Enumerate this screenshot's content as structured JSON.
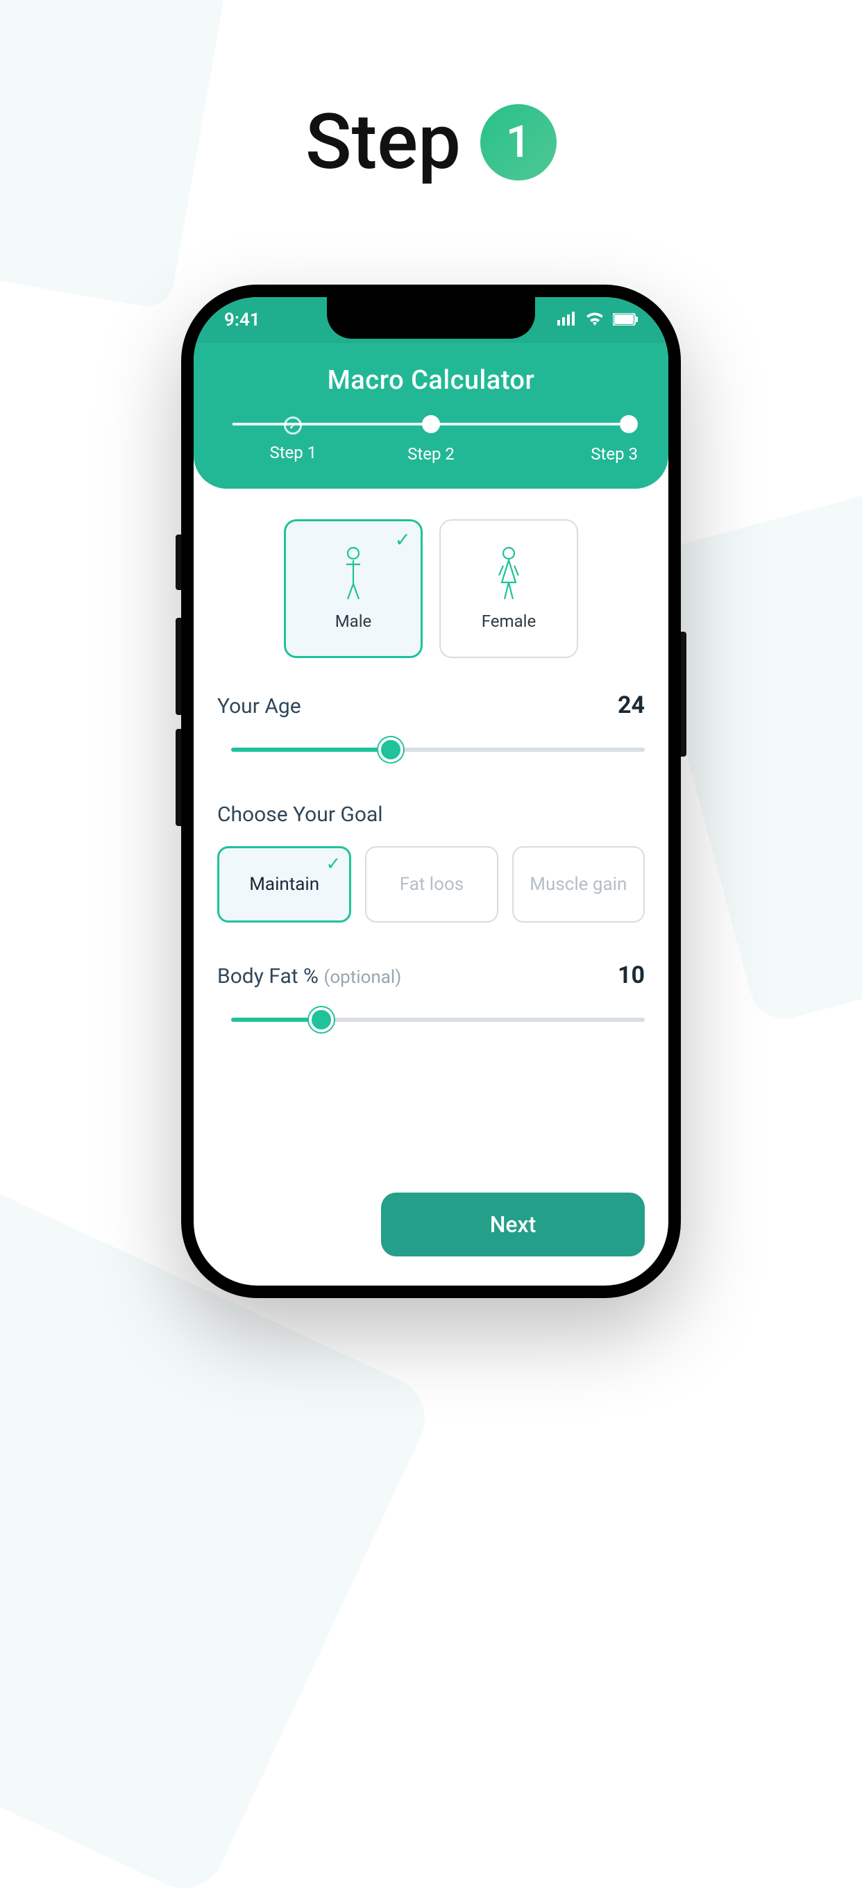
{
  "page": {
    "step_word": "Step",
    "step_number": "1"
  },
  "status": {
    "time": "9:41"
  },
  "header": {
    "title": "Macro  Calculator",
    "steps": [
      "Step 1",
      "Step 2",
      "Step 3"
    ]
  },
  "gender": {
    "options": [
      "Male",
      "Female"
    ],
    "selected": "Male"
  },
  "age": {
    "label": "Your Age",
    "value": "24"
  },
  "goal": {
    "title": "Choose Your Goal",
    "options": [
      "Maintain",
      "Fat loos",
      "Muscle gain"
    ],
    "selected": "Maintain"
  },
  "bodyfat": {
    "label": "Body Fat % ",
    "optional": "(optional)",
    "value": "10"
  },
  "actions": {
    "next": "Next"
  }
}
